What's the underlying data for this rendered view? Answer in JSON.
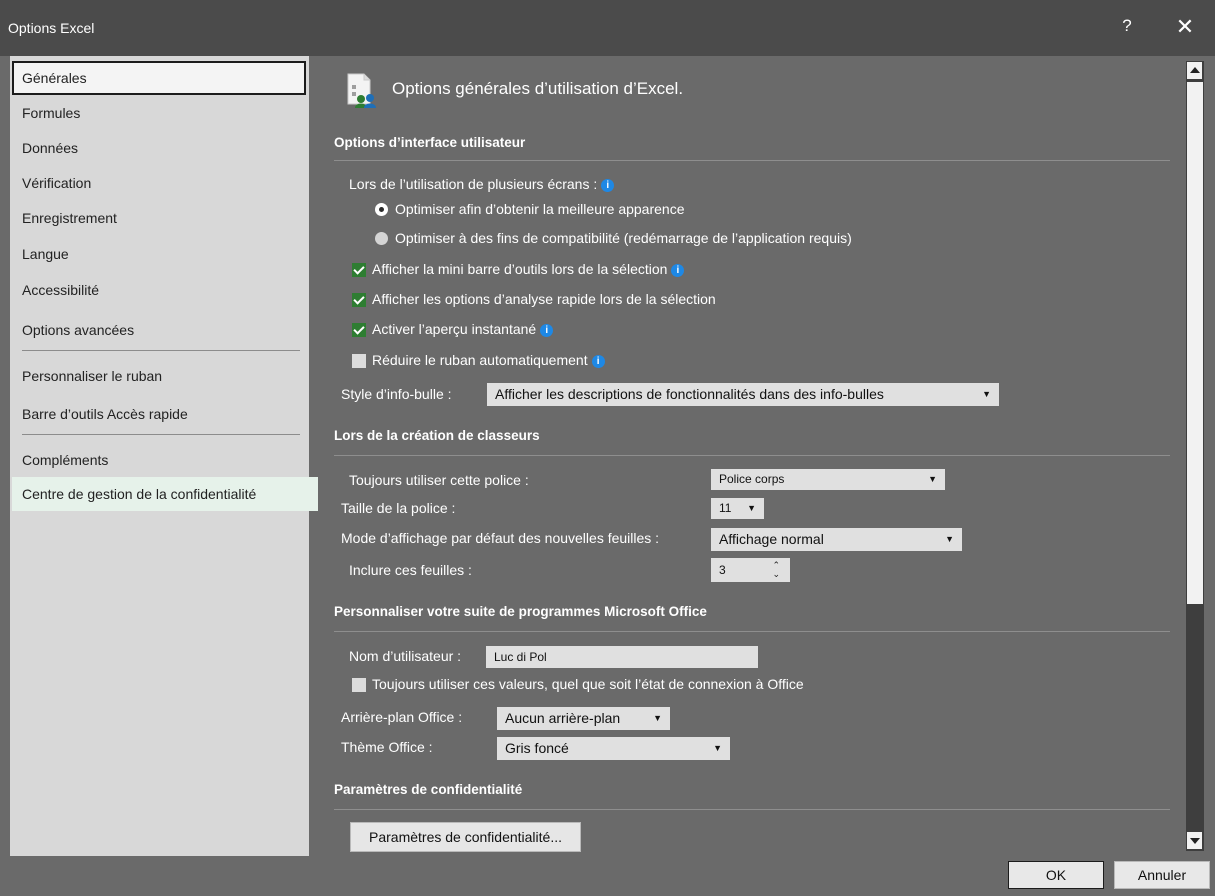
{
  "window": {
    "title": "Options Excel",
    "help": "?",
    "close": "✕"
  },
  "sidebar": {
    "items": [
      {
        "label": "Générales"
      },
      {
        "label": "Formules"
      },
      {
        "label": "Données"
      },
      {
        "label": "Vérification"
      },
      {
        "label": "Enregistrement"
      },
      {
        "label": "Langue"
      },
      {
        "label": "Accessibilité"
      },
      {
        "label": "Options avancées"
      },
      {
        "label": "Personnaliser le ruban"
      },
      {
        "label": "Barre d’outils Accès rapide"
      },
      {
        "label": "Compléments"
      },
      {
        "label": "Centre de gestion de la confidentialité"
      }
    ]
  },
  "main": {
    "page_title": "Options générales d’utilisation d’Excel.",
    "ui_section": {
      "heading": "Options d’interface utilisateur",
      "multi_screen_label": "Lors de l’utilisation de plusieurs écrans :",
      "radio_best": "Optimiser afin d’obtenir la meilleure apparence",
      "radio_compat": "Optimiser à des fins de compatibilité (redémarrage de l’application requis)",
      "cb_mini_toolbar": "Afficher la mini barre d’outils lors de la sélection",
      "cb_quick_analysis": "Afficher les options d’analyse rapide lors de la sélection",
      "cb_live_preview": "Activer l’aperçu instantané",
      "cb_collapse_ribbon": "Réduire le ruban automatiquement",
      "tooltip_label": "Style d’info-bulle :",
      "tooltip_value": "Afficher les descriptions de fonctionnalités dans des info-bulles"
    },
    "workbook_section": {
      "heading": "Lors de la création de classeurs",
      "font_label": "Toujours utiliser cette police :",
      "font_value": "Police corps",
      "size_label": "Taille de la police :",
      "size_value": "11",
      "view_label": "Mode d’affichage par défaut des nouvelles feuilles :",
      "view_value": "Affichage normal",
      "sheets_label": "Inclure ces feuilles :",
      "sheets_value": "3"
    },
    "office_section": {
      "heading": "Personnaliser votre suite de programmes Microsoft Office",
      "username_label": "Nom d’utilisateur :",
      "username_value": "Luc di Pol",
      "cb_always_values": "Toujours utiliser ces valeurs, quel que soit l’état de connexion à Office",
      "background_label": "Arrière-plan Office :",
      "background_value": "Aucun arrière-plan",
      "theme_label": "Thème Office :",
      "theme_value": "Gris foncé"
    },
    "privacy_section": {
      "heading": "Paramètres de confidentialité",
      "button": "Paramètres de confidentialité..."
    }
  },
  "footer": {
    "ok": "OK",
    "cancel": "Annuler"
  },
  "colors": {
    "title_bar": "#4b4b4b",
    "body": "#6a6a6a",
    "sidebar": "#d8d8d8",
    "check": "#2e7d32",
    "info": "#1e88e5"
  }
}
